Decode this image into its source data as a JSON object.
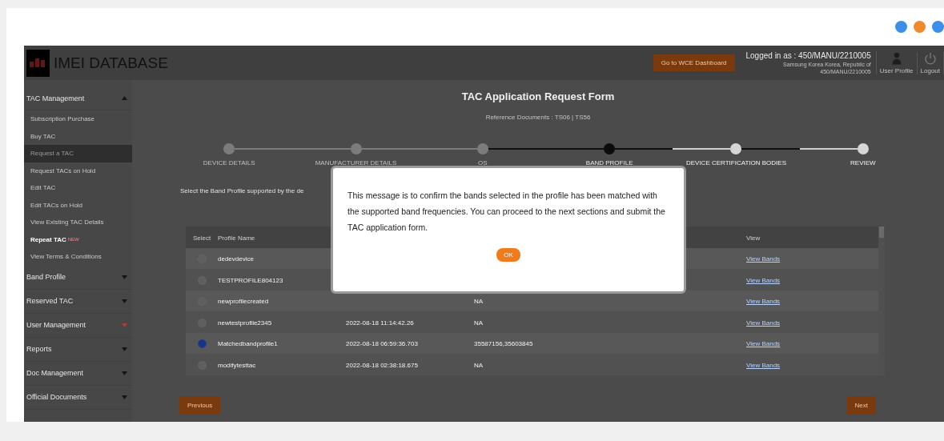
{
  "header": {
    "app_title": "IMEI DATABASE",
    "dashboard_button": "Go to WCE Dashboard",
    "logged_in": "Logged in as : 450/MANU/2210005",
    "company": "Samsung Korea Korea, Republic of",
    "user_id": "450/MANU/2210005",
    "user_profile": "User Profile",
    "logout": "Logout"
  },
  "sidebar": [
    {
      "label": "TAC Management",
      "expanded": true,
      "children": [
        {
          "label": "Subscription Purchase",
          "selected": false
        },
        {
          "label": "Buy TAC",
          "selected": false
        },
        {
          "label": "Request a TAC",
          "selected": true
        },
        {
          "label": "Request TACs on Hold",
          "selected": false
        },
        {
          "label": "Edit TAC",
          "selected": false
        },
        {
          "label": "Edit TACs on Hold",
          "selected": false
        },
        {
          "label": "View Existing TAC Details",
          "selected": false
        },
        {
          "label": "Repeat TAC",
          "selected": false,
          "badge": "NEW"
        },
        {
          "label": "View Terms & Conditions",
          "selected": false
        }
      ]
    },
    {
      "label": "Band Profile",
      "expanded": false
    },
    {
      "label": "Reserved TAC",
      "expanded": false
    },
    {
      "label": "User Management",
      "expanded": false
    },
    {
      "label": "Reports",
      "expanded": false
    },
    {
      "label": "Doc Management",
      "expanded": false
    },
    {
      "label": "Official Documents",
      "expanded": false
    }
  ],
  "form": {
    "title": "TAC Application Request Form",
    "subtitle": "Reference Documents : TS06 | TS56",
    "steps": [
      {
        "label": "DEVICE DETAILS",
        "kind": "done"
      },
      {
        "label": "MANUFACTURER DETAILS",
        "kind": "done"
      },
      {
        "label": "OS",
        "kind": "done"
      },
      {
        "label": "BAND PROFILE",
        "kind": "current"
      },
      {
        "label": "DEVICE CERTIFICATION BODIES",
        "kind": "todo"
      },
      {
        "label": "REVIEW",
        "kind": "todo"
      }
    ],
    "instruction": "Select the Band Profile supported by the de",
    "table": {
      "columns": [
        "Select",
        "Profile Name",
        "View"
      ],
      "rows": [
        {
          "selected": false,
          "name": "dedevdevice",
          "view": "View Bands"
        },
        {
          "selected": false,
          "name": "TESTPROFILE804123",
          "view": "View Bands"
        },
        {
          "selected": false,
          "name": "newprofilecreated",
          "bands": "NA",
          "view": "View Bands"
        },
        {
          "selected": false,
          "name": "newtestprofile2345",
          "date": "2022-08-18 11:14:42.26",
          "bands": "NA",
          "view": "View Bands"
        },
        {
          "selected": true,
          "name": "Matchedbandprofile1",
          "date": "2022-08-18 06:59:36.703",
          "bands": "35587156,35603845",
          "view": "View Bands"
        },
        {
          "selected": false,
          "name": "modifytesttac",
          "date": "2022-08-18 02:38:18.675",
          "bands": "NA",
          "view": "View Bands"
        }
      ]
    },
    "previous_button": "Previous",
    "next_button": "Next"
  },
  "dialog": {
    "message": "This message is to confirm the bands selected in the profile has been matched with the supported band frequencies. You can proceed to the next sections and submit the TAC application form.",
    "ok_button": "OK"
  }
}
